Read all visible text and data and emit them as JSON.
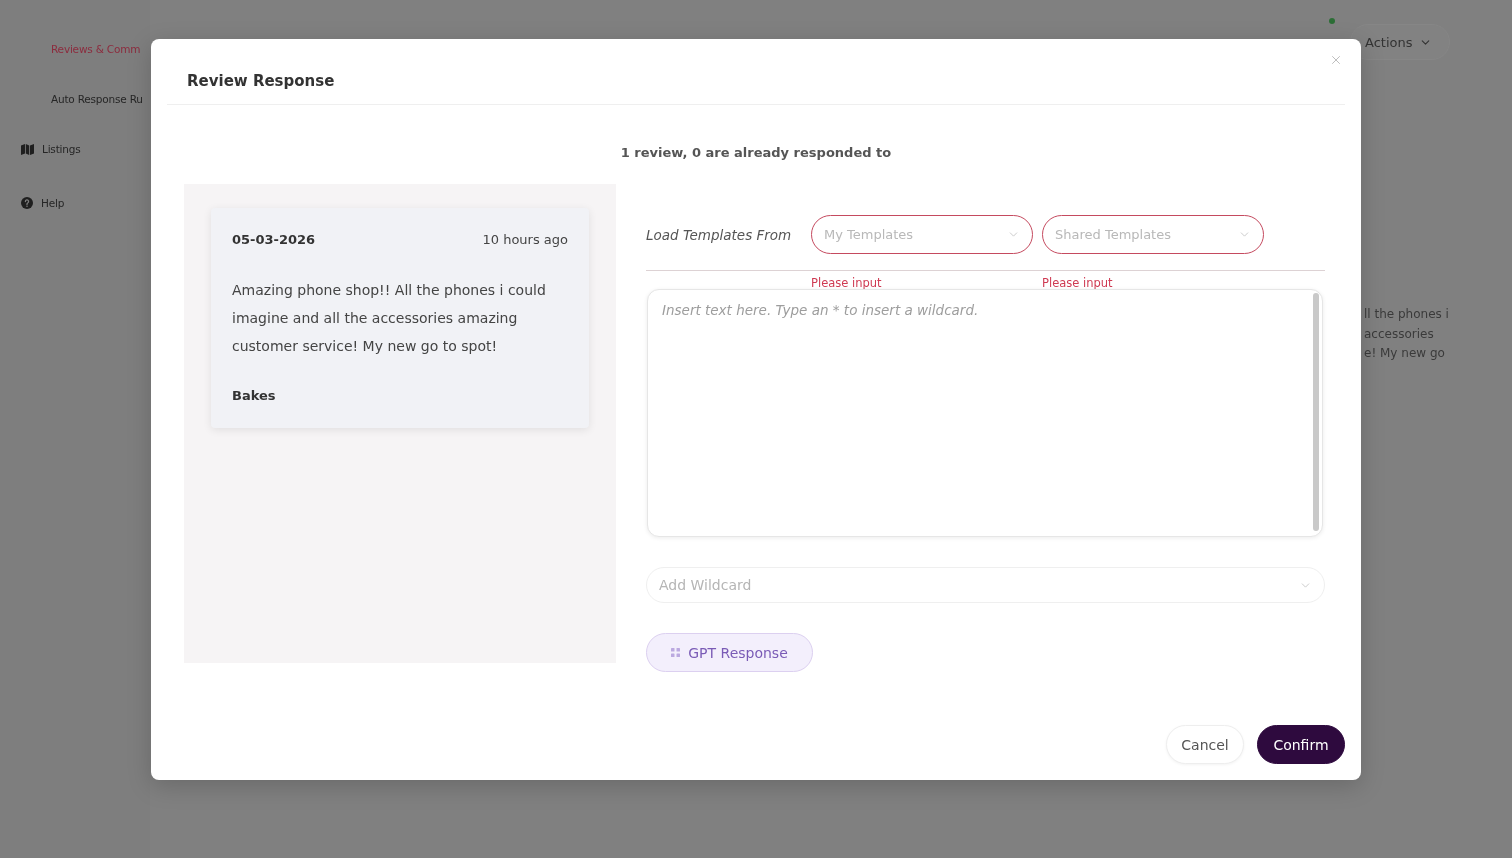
{
  "background": {
    "sidebar": {
      "items": [
        {
          "label": "Reviews & Comm",
          "kind": "sub",
          "selected": true
        },
        {
          "label": "Auto Response Ru",
          "kind": "sub",
          "selected": false
        },
        {
          "label": "Listings",
          "kind": "map",
          "selected": false
        },
        {
          "label": "Help",
          "kind": "help",
          "selected": false
        }
      ]
    },
    "topbar": {
      "actions_button": "Actions"
    },
    "review_snippet": [
      "ll the phones i",
      "accessories",
      "e! My new go"
    ]
  },
  "modal": {
    "title": "Review Response",
    "summary": "1 review, 0 are already responded to",
    "review": {
      "date": "05-03-2026",
      "age": "10 hours ago",
      "text": "Amazing phone shop!! All the phones i could imagine and all the accessories amazing customer service! My new go to spot!",
      "author": "Bakes"
    },
    "templates": {
      "label": "Load Templates From",
      "selects": [
        {
          "placeholder": "My Templates",
          "error": "Please input"
        },
        {
          "placeholder": "Shared Templates",
          "error": "Please input"
        }
      ]
    },
    "response_field": {
      "placeholder": "Insert text here. Type an * to insert a wildcard."
    },
    "wildcard_select": {
      "placeholder": "Add Wildcard"
    },
    "gpt_button": "GPT Response",
    "buttons": [
      {
        "label": "Cancel",
        "kind": "secondary"
      },
      {
        "label": "Confirm",
        "kind": "primary"
      }
    ]
  }
}
